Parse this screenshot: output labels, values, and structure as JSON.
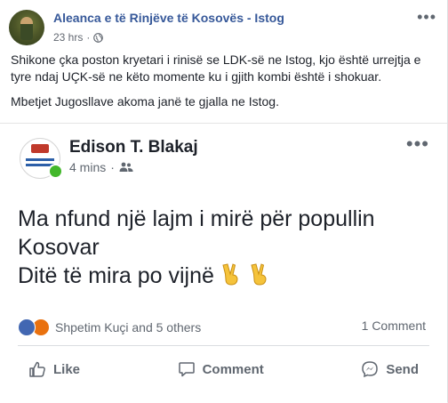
{
  "post": {
    "page_name": "Aleanca e të Rinjëve të Kosovës - Istog",
    "time": "23 hrs",
    "caption_lines": [
      "Shikone çka poston kryetari i rinisë se LDK-së ne Istog, kjo është urrejtja e tyre ndaj UÇK-së ne këto momente ku i gjith kombi është i shokuar.",
      "Mbetjet Jugosllave akoma janë te gjalla ne Istog."
    ]
  },
  "shared": {
    "author": "Edison T. Blakaj",
    "time": "4 mins",
    "text_line1": "Ma nfund një lajm i mirë për popullin Kosovar",
    "text_line2": "Ditë të mira po vijnë",
    "reactions_text": "Shpetim Kuçi and 5 others",
    "comments_text": "1 Comment",
    "actions": {
      "like": "Like",
      "comment": "Comment",
      "send": "Send"
    }
  }
}
